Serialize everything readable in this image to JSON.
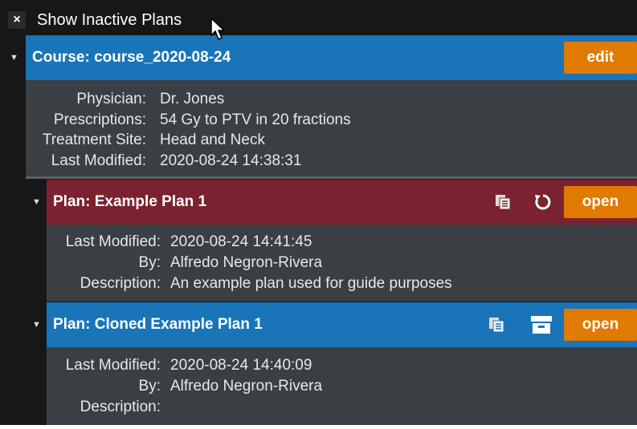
{
  "toolbar": {
    "close_glyph": "×",
    "show_inactive_label": "Show Inactive Plans"
  },
  "course": {
    "title": "Course: course_2020-08-24",
    "edit_label": "edit",
    "details": [
      {
        "label": "Physician:",
        "value": "Dr. Jones"
      },
      {
        "label": "Prescriptions:",
        "value": "54 Gy to PTV in 20 fractions"
      },
      {
        "label": "Treatment Site:",
        "value": "Head and Neck"
      },
      {
        "label": "Last Modified:",
        "value": "2020-08-24 14:38:31"
      }
    ]
  },
  "plans": [
    {
      "title": "Plan: Example Plan 1",
      "header_color": "#7a2230",
      "open_label": "open",
      "icons": [
        "copy-icon",
        "restore-icon"
      ],
      "details": [
        {
          "label": "Last Modified:",
          "value": "2020-08-24 14:41:45"
        },
        {
          "label": "By:",
          "value": "Alfredo Negron-Rivera"
        },
        {
          "label": "Description:",
          "value": "An example plan used for guide purposes"
        }
      ]
    },
    {
      "title": "Plan: Cloned Example Plan 1",
      "header_color": "#1a74b8",
      "open_label": "open",
      "icons": [
        "copy-icon",
        "archive-icon"
      ],
      "details": [
        {
          "label": "Last Modified:",
          "value": "2020-08-24 14:40:09"
        },
        {
          "label": "By:",
          "value": "Alfredo Negron-Rivera"
        },
        {
          "label": "Description:",
          "value": ""
        }
      ]
    }
  ],
  "colors": {
    "course_header": "#1a74b8",
    "accent_orange": "#e07a00",
    "details_bg": "#3a3f44",
    "panel_bg": "#171717"
  }
}
